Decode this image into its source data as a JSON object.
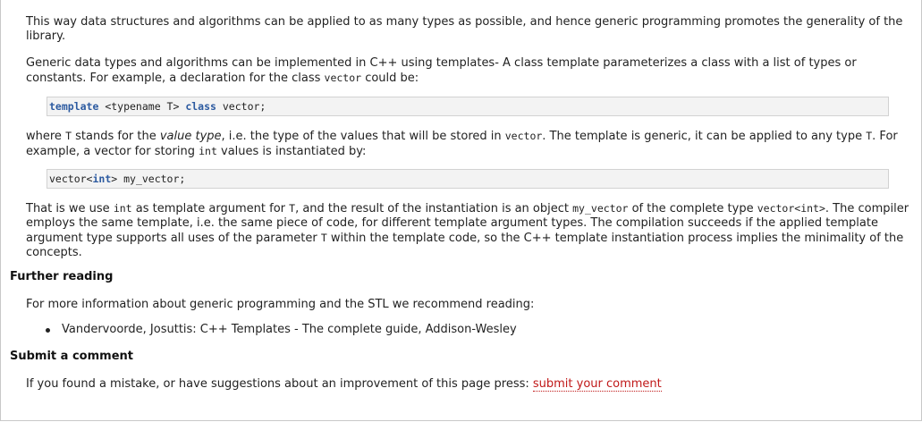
{
  "para1": "This way data structures and algorithms can be applied to as many types as possible, and hence generic programming promotes the generality of the library.",
  "para2": {
    "text": "Generic data types and algorithms can be implemented in C++ using templates- A class template parameterizes a class with a list of types or constants. For example, a declaration for the class ",
    "code_vector": "vector",
    "tail": " could be:"
  },
  "code1": {
    "kw_template": "template",
    "mid": " <typename T> ",
    "kw_class": "class",
    "tail": " vector;"
  },
  "para3": {
    "a": "where ",
    "T1": "T",
    "b": " stands for the ",
    "value_type": "value type",
    "c": ", i.e. the type of the values that will be stored in ",
    "vector": "vector",
    "d": ". The template is generic, it can be applied to any type ",
    "T2": "T",
    "e": ". For example, a vector for storing ",
    "int": "int",
    "f": " values is instantiated by:"
  },
  "code2": {
    "a": "vector<",
    "kw_int": "int",
    "b": "> my_vector;"
  },
  "para4": {
    "a": "That is we use ",
    "int": "int",
    "b": " as template argument for ",
    "T1": "T",
    "c": ", and the result of the instantiation is an object ",
    "my_vector": "my_vector",
    "d": " of the complete type ",
    "vector_int": "vector<int>",
    "e": ". The compiler employs the same template, i.e. the same piece of code, for different template argument types. The compilation succeeds if the applied template argument type supports all uses of the parameter ",
    "T2": "T",
    "f": " within the template code, so the C++ template instantiation process implies the minimality of the concepts."
  },
  "further_reading": {
    "heading": "Further reading",
    "intro": "For more information about generic programming and the STL we recommend reading:",
    "items": [
      "Vandervoorde, Josuttis: C++ Templates - The complete guide, Addison-Wesley"
    ]
  },
  "submit": {
    "heading": "Submit a comment",
    "text": "If you found a mistake, or have suggestions about an improvement of this page press: ",
    "link": "submit your comment"
  },
  "colors": {
    "link": "#c01818",
    "keyword": "#2c5aa0",
    "code_bg": "#f3f3f3"
  }
}
